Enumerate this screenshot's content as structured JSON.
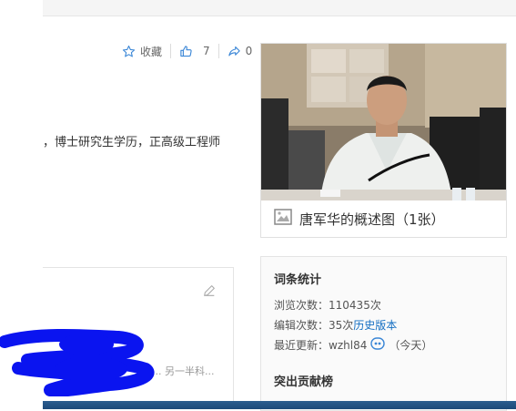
{
  "actions": {
    "favorite_label": "收藏",
    "like_count": "7",
    "share_count": "0"
  },
  "summary": {
    "text": "，博士研究生学历，正高级工程师"
  },
  "photo_card": {
    "caption": "唐军华的概述图（1张）"
  },
  "left_card": {
    "tail_text": "... 另一半科..."
  },
  "stats": {
    "title": "词条统计",
    "views_label": "浏览次数：",
    "views_value": "110435次",
    "edits_label": "编辑次数：",
    "edits_value": "35次",
    "history_link": "历史版本",
    "updated_label": "最近更新：",
    "updated_user": "wzhl84",
    "updated_when": "（今天）",
    "contributors_title": "突出贡献榜"
  }
}
